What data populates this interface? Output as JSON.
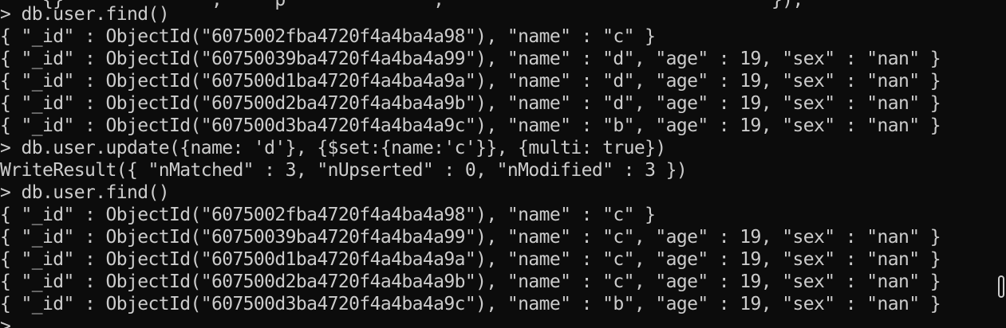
{
  "terminal": {
    "partial_top_line": "    {}              ,     p              ,                               }),",
    "lines": [
      "> db.user.find()",
      "{ \"_id\" : ObjectId(\"6075002fba4720f4a4ba4a98\"), \"name\" : \"c\" }",
      "{ \"_id\" : ObjectId(\"60750039ba4720f4a4ba4a99\"), \"name\" : \"d\", \"age\" : 19, \"sex\" : \"nan\" }",
      "{ \"_id\" : ObjectId(\"607500d1ba4720f4a4ba4a9a\"), \"name\" : \"d\", \"age\" : 19, \"sex\" : \"nan\" }",
      "{ \"_id\" : ObjectId(\"607500d2ba4720f4a4ba4a9b\"), \"name\" : \"d\", \"age\" : 19, \"sex\" : \"nan\" }",
      "{ \"_id\" : ObjectId(\"607500d3ba4720f4a4ba4a9c\"), \"name\" : \"b\", \"age\" : 19, \"sex\" : \"nan\" }",
      "> db.user.update({name: 'd'}, {$set:{name:'c'}}, {multi: true})",
      "WriteResult({ \"nMatched\" : 3, \"nUpserted\" : 0, \"nModified\" : 3 })",
      "> db.user.find()",
      "{ \"_id\" : ObjectId(\"6075002fba4720f4a4ba4a98\"), \"name\" : \"c\" }",
      "{ \"_id\" : ObjectId(\"60750039ba4720f4a4ba4a99\"), \"name\" : \"c\", \"age\" : 19, \"sex\" : \"nan\" }",
      "{ \"_id\" : ObjectId(\"607500d1ba4720f4a4ba4a9a\"), \"name\" : \"c\", \"age\" : 19, \"sex\" : \"nan\" }",
      "{ \"_id\" : ObjectId(\"607500d2ba4720f4a4ba4a9b\"), \"name\" : \"c\", \"age\" : 19, \"sex\" : \"nan\" }",
      "{ \"_id\" : ObjectId(\"607500d3ba4720f4a4ba4a9c\"), \"name\" : \"b\", \"age\" : 19, \"sex\" : \"nan\" }",
      ">"
    ],
    "colors": {
      "background": "#0c0c0c",
      "text": "#cccccc"
    }
  }
}
